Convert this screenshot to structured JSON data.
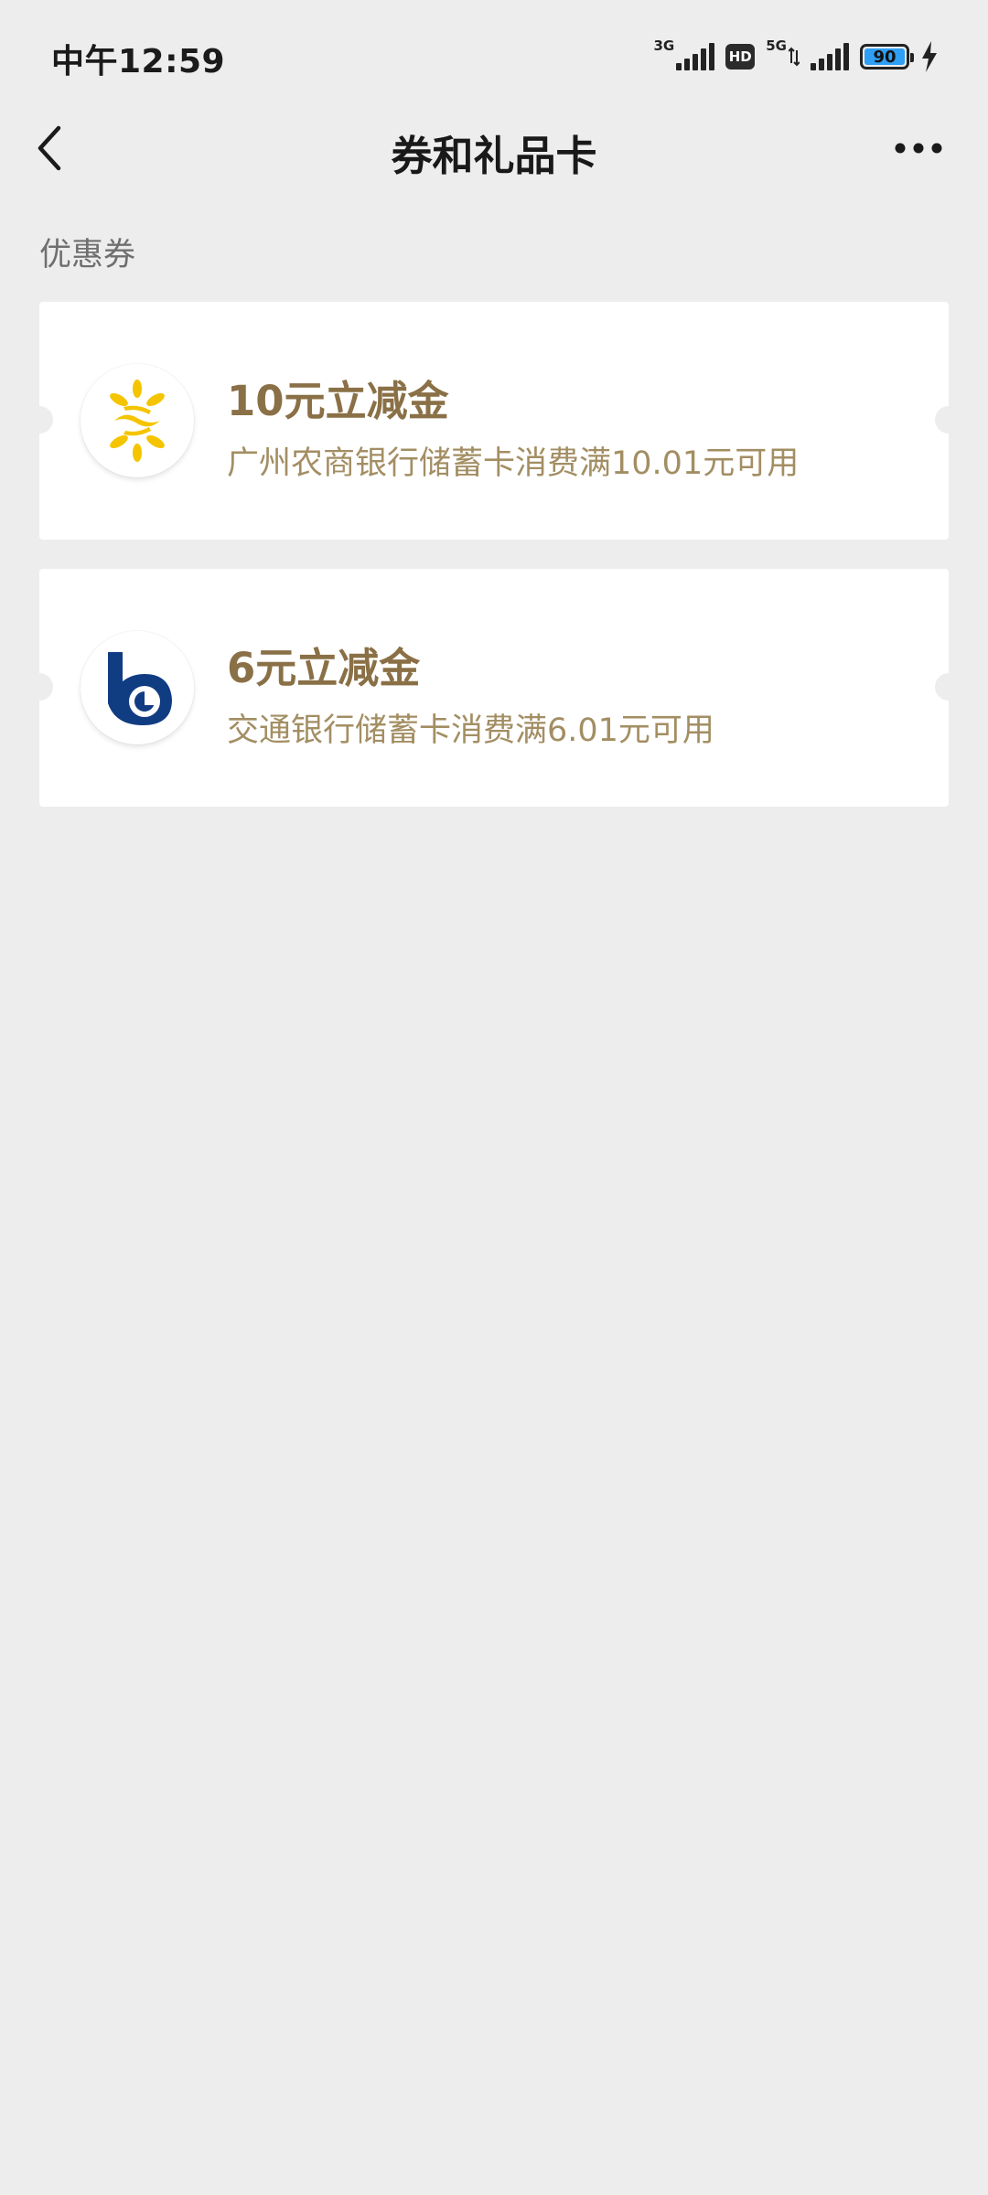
{
  "status_bar": {
    "time": "中午12:59",
    "network1_label": "3G",
    "hd_label": "HD",
    "network2_label": "5G",
    "battery_level": "90"
  },
  "header": {
    "title": "券和礼品卡",
    "back_icon": "chevron-left-icon",
    "more_icon": "more-horizontal-icon"
  },
  "section": {
    "title": "优惠券"
  },
  "coupons": [
    {
      "title": "10元立减金",
      "description": "广州农商银行储蓄卡消费满10.01元可用",
      "logo": "grcb-bank-logo-icon",
      "logo_color": "#f5c400"
    },
    {
      "title": "6元立减金",
      "description": "交通银行储蓄卡消费满6.01元可用",
      "logo": "bocom-bank-logo-icon",
      "logo_color": "#103c82"
    }
  ],
  "colors": {
    "background": "#ededed",
    "card": "#ffffff",
    "coupon_title": "#8a7046",
    "coupon_desc": "#a38e63"
  }
}
